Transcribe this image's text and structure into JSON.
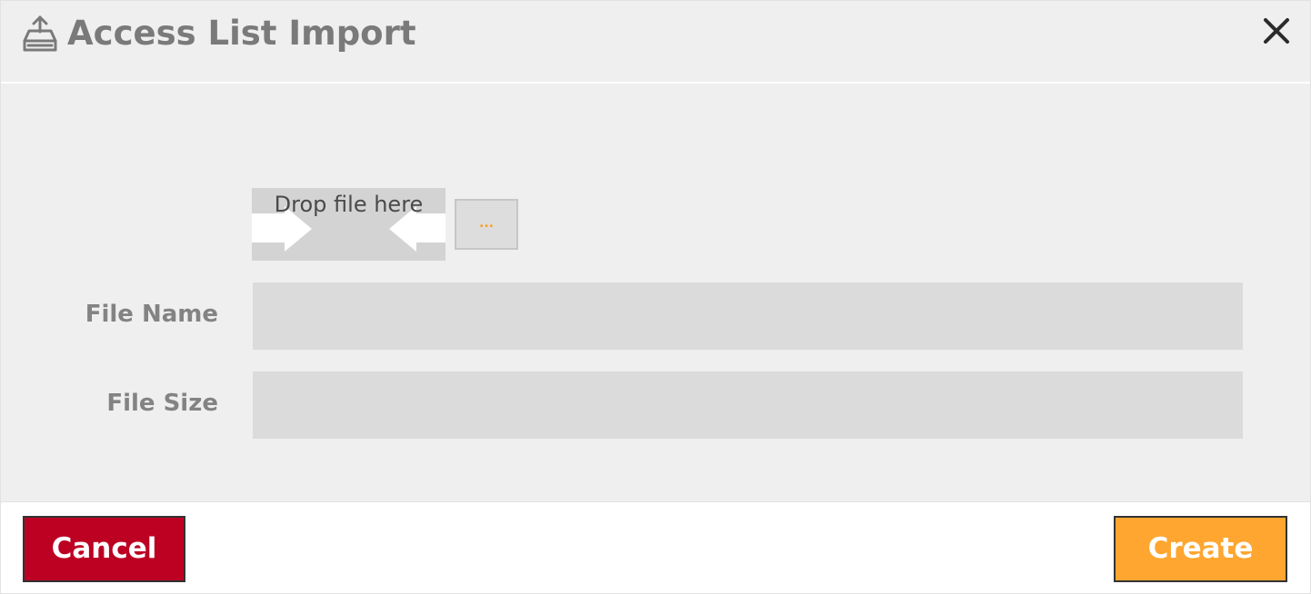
{
  "dialog": {
    "title": "Access List Import",
    "header_icon": "upload-tray-icon",
    "close_icon": "close-icon"
  },
  "dropzone": {
    "label": "Drop file here",
    "browse_label": "..."
  },
  "fields": {
    "file_name": {
      "label": "File Name",
      "value": ""
    },
    "file_size": {
      "label": "File Size",
      "value": ""
    }
  },
  "footer": {
    "cancel_label": "Cancel",
    "create_label": "Create"
  },
  "colors": {
    "cancel": "#bd0123",
    "create": "#fea630",
    "browse_dots": "#f5a02c"
  }
}
